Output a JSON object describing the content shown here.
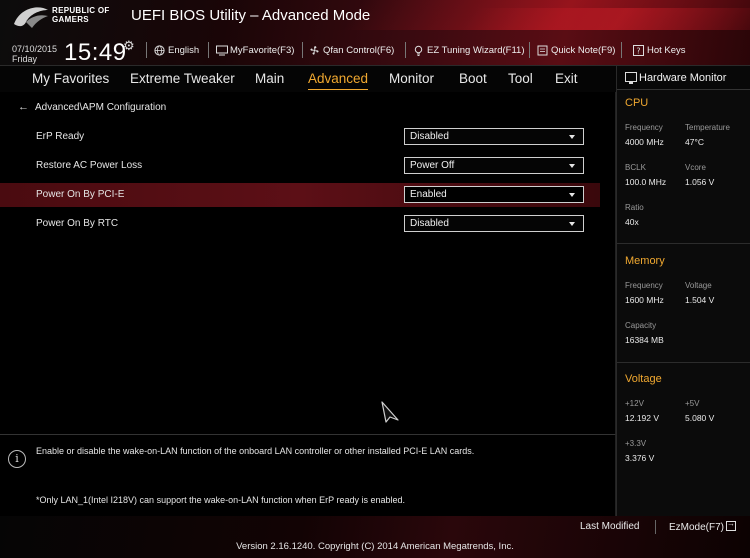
{
  "header": {
    "brand_line1": "REPUBLIC OF",
    "brand_line2": "GAMERS",
    "title": "UEFI BIOS Utility – Advanced Mode"
  },
  "infobar": {
    "date": "07/10/2015",
    "day": "Friday",
    "time": "15:49",
    "language": "English",
    "my_favorite": "MyFavorite(F3)",
    "qfan": "Qfan Control(F6)",
    "ez_tuning": "EZ Tuning Wizard(F11)",
    "quick_note": "Quick Note(F9)",
    "hot_keys": "Hot Keys"
  },
  "tabs": [
    {
      "label": "My Favorites"
    },
    {
      "label": "Extreme Tweaker"
    },
    {
      "label": "Main"
    },
    {
      "label": "Advanced",
      "active": true
    },
    {
      "label": "Monitor"
    },
    {
      "label": "Boot"
    },
    {
      "label": "Tool"
    },
    {
      "label": "Exit"
    }
  ],
  "breadcrumb": "Advanced\\APM Configuration",
  "settings": [
    {
      "label": "ErP Ready",
      "value": "Disabled"
    },
    {
      "label": "Restore AC Power Loss",
      "value": "Power Off"
    },
    {
      "label": "Power On By PCI-E",
      "value": "Enabled",
      "selected": true
    },
    {
      "label": "Power On By RTC",
      "value": "Disabled"
    }
  ],
  "help": {
    "description": "Enable or disable the wake-on-LAN function of the onboard LAN controller or other installed PCI-E LAN cards.",
    "note": "*Only LAN_1(Intel I218V) can support the wake-on-LAN function when ErP ready is enabled."
  },
  "hardware_monitor": {
    "title": "Hardware Monitor",
    "cpu": {
      "heading": "CPU",
      "frequency_label": "Frequency",
      "frequency": "4000 MHz",
      "temperature_label": "Temperature",
      "temperature": "47°C",
      "bclk_label": "BCLK",
      "bclk": "100.0 MHz",
      "vcore_label": "Vcore",
      "vcore": "1.056 V",
      "ratio_label": "Ratio",
      "ratio": "40x"
    },
    "memory": {
      "heading": "Memory",
      "frequency_label": "Frequency",
      "frequency": "1600 MHz",
      "voltage_label": "Voltage",
      "voltage": "1.504 V",
      "capacity_label": "Capacity",
      "capacity": "16384 MB"
    },
    "voltage": {
      "heading": "Voltage",
      "v12_label": "+12V",
      "v12": "12.192 V",
      "v5_label": "+5V",
      "v5": "5.080 V",
      "v33_label": "+3.3V",
      "v33": "3.376 V"
    }
  },
  "footer": {
    "last_modified": "Last Modified",
    "ez_mode": "EzMode(F7)",
    "version": "Version 2.16.1240. Copyright (C) 2014 American Megatrends, Inc."
  },
  "colors": {
    "accent": "#f0a830",
    "selected_row": "#5c0f16"
  }
}
